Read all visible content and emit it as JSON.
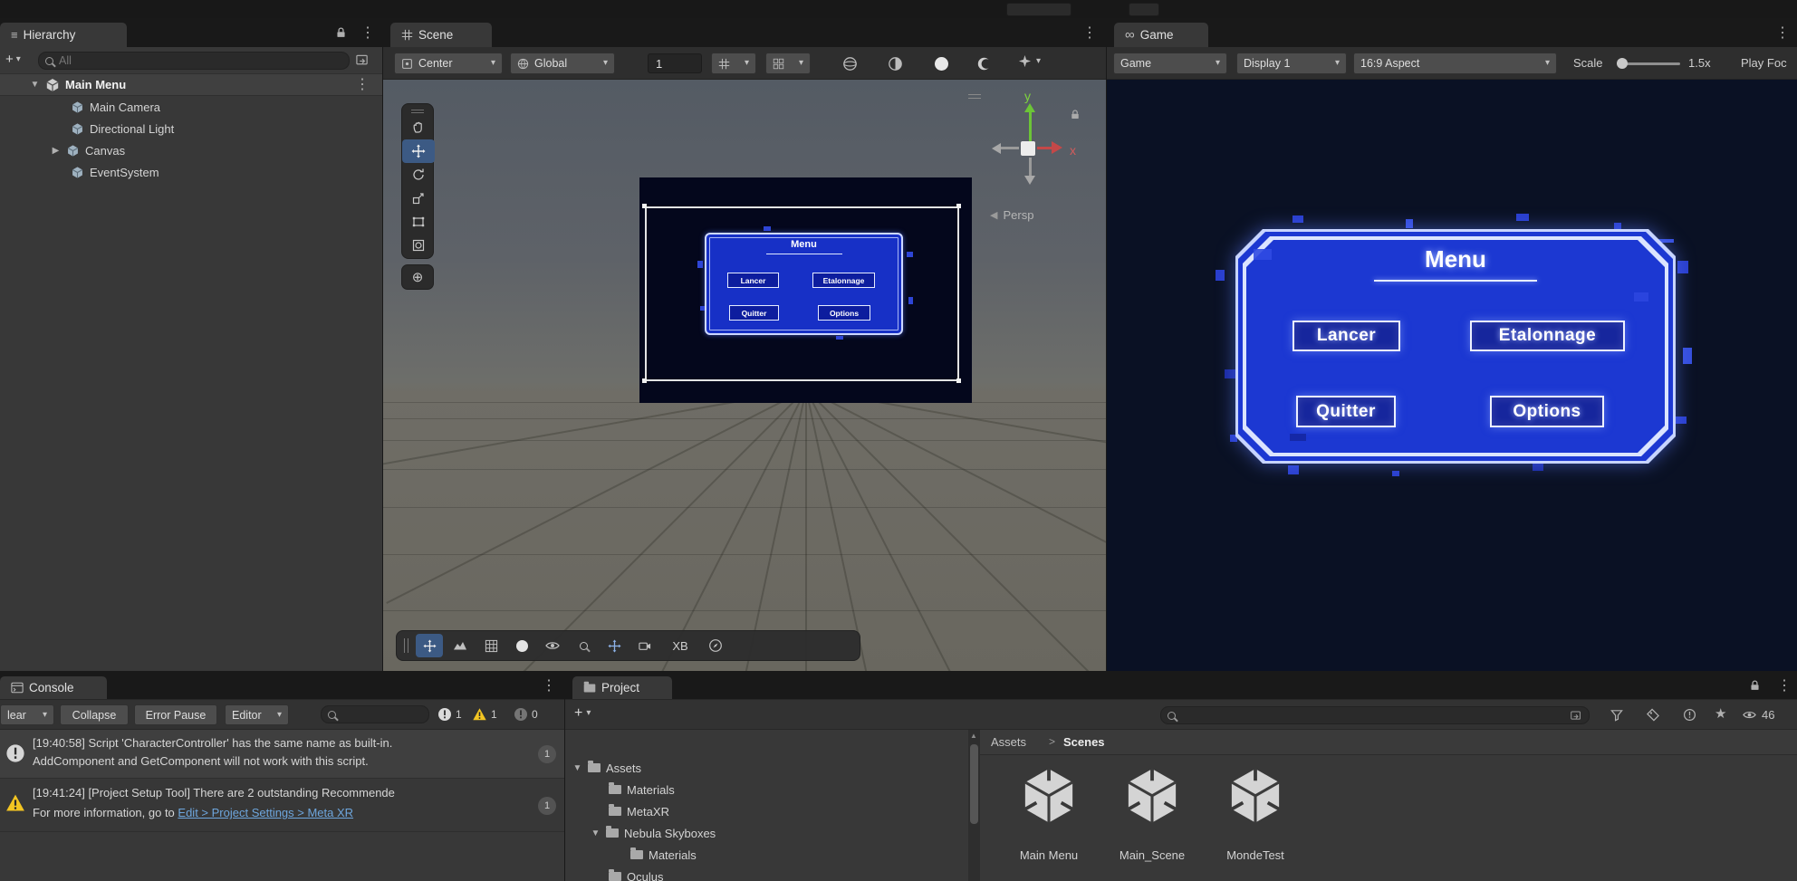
{
  "icons": {
    "hamburger": "≡",
    "kebab": "⋮",
    "caret": "▾",
    "expanded": "▼",
    "collapsed": "▶",
    "plus": "+",
    "infinity": "∞",
    "persp_arrow": "◀",
    "breadcrumb_sep": ">",
    "scroll_up": "▲",
    "circle_filled": "●",
    "target": "⊕"
  },
  "hierarchy": {
    "tab": "Hierarchy",
    "search_placeholder": "All",
    "root": {
      "label": "Main Menu"
    },
    "items": [
      {
        "label": "Main Camera"
      },
      {
        "label": "Directional Light"
      },
      {
        "label": "Canvas"
      },
      {
        "label": "EventSystem"
      }
    ]
  },
  "scene_view": {
    "tab": "Scene",
    "toolbar": {
      "pivot": "Center",
      "orientation": "Global",
      "snap_value": "1"
    },
    "gizmo": {
      "x_label": "x",
      "y_label": "y",
      "persp": "Persp"
    },
    "canvas_menu": {
      "title": "Menu",
      "buttons": [
        "Lancer",
        "Etalonnage",
        "Quitter",
        "Options"
      ]
    },
    "footer": {
      "xb": "XB"
    }
  },
  "game_view": {
    "tab": "Game",
    "toolbar": {
      "target": "Game",
      "display": "Display 1",
      "aspect": "16:9 Aspect",
      "scale_label": "Scale",
      "scale_value": "1.5x",
      "play_focused": "Play Foc"
    },
    "menu": {
      "title": "Menu",
      "buttons": [
        "Lancer",
        "Etalonnage",
        "Quitter",
        "Options"
      ]
    }
  },
  "console": {
    "tab": "Console",
    "toolbar": {
      "clear": "lear",
      "collapse": "Collapse",
      "error_pause": "Error Pause",
      "editor": "Editor"
    },
    "counts": {
      "info": "1",
      "warning": "1",
      "error": "0"
    },
    "entries": [
      {
        "line1": "[19:40:58] Script 'CharacterController' has the same name as built-in.",
        "line2": "AddComponent and GetComponent will not work with this script.",
        "badge": "1"
      },
      {
        "line1": "[19:41:24] [Project Setup Tool] There are 2 outstanding Recommende",
        "line2_prefix": "For more information, go to ",
        "line2_link": "Edit > Project Settings > Meta XR",
        "badge": "1"
      }
    ]
  },
  "project": {
    "tab": "Project",
    "toolbar": {
      "eye_count": "46"
    },
    "breadcrumb": {
      "root": "Assets",
      "current": "Scenes"
    },
    "tree": [
      {
        "label": "Assets"
      },
      {
        "label": "Materials"
      },
      {
        "label": "MetaXR"
      },
      {
        "label": "Nebula Skyboxes"
      },
      {
        "label": "Materials"
      },
      {
        "label": "Oculus"
      }
    ],
    "assets": [
      {
        "label": "Main Menu"
      },
      {
        "label": "Main_Scene"
      },
      {
        "label": "MondeTest"
      }
    ]
  }
}
